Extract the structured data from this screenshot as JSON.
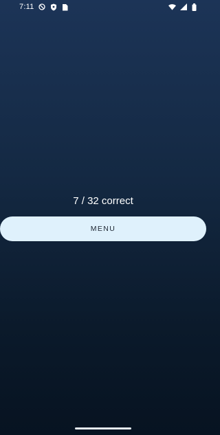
{
  "status_bar": {
    "time": "7:11",
    "left_icons": [
      "do-not-disturb-icon",
      "shield-icon",
      "sim-card-icon"
    ],
    "right_icons": [
      "wifi-icon",
      "signal-icon",
      "battery-icon"
    ]
  },
  "quiz_result": {
    "score_text": "7 / 32 correct"
  },
  "actions": {
    "menu_label": "MENU"
  },
  "colors": {
    "background_top": "#1c3457",
    "background_bottom": "#071321",
    "button_background": "#dff1fc",
    "button_text": "#1b2430"
  }
}
